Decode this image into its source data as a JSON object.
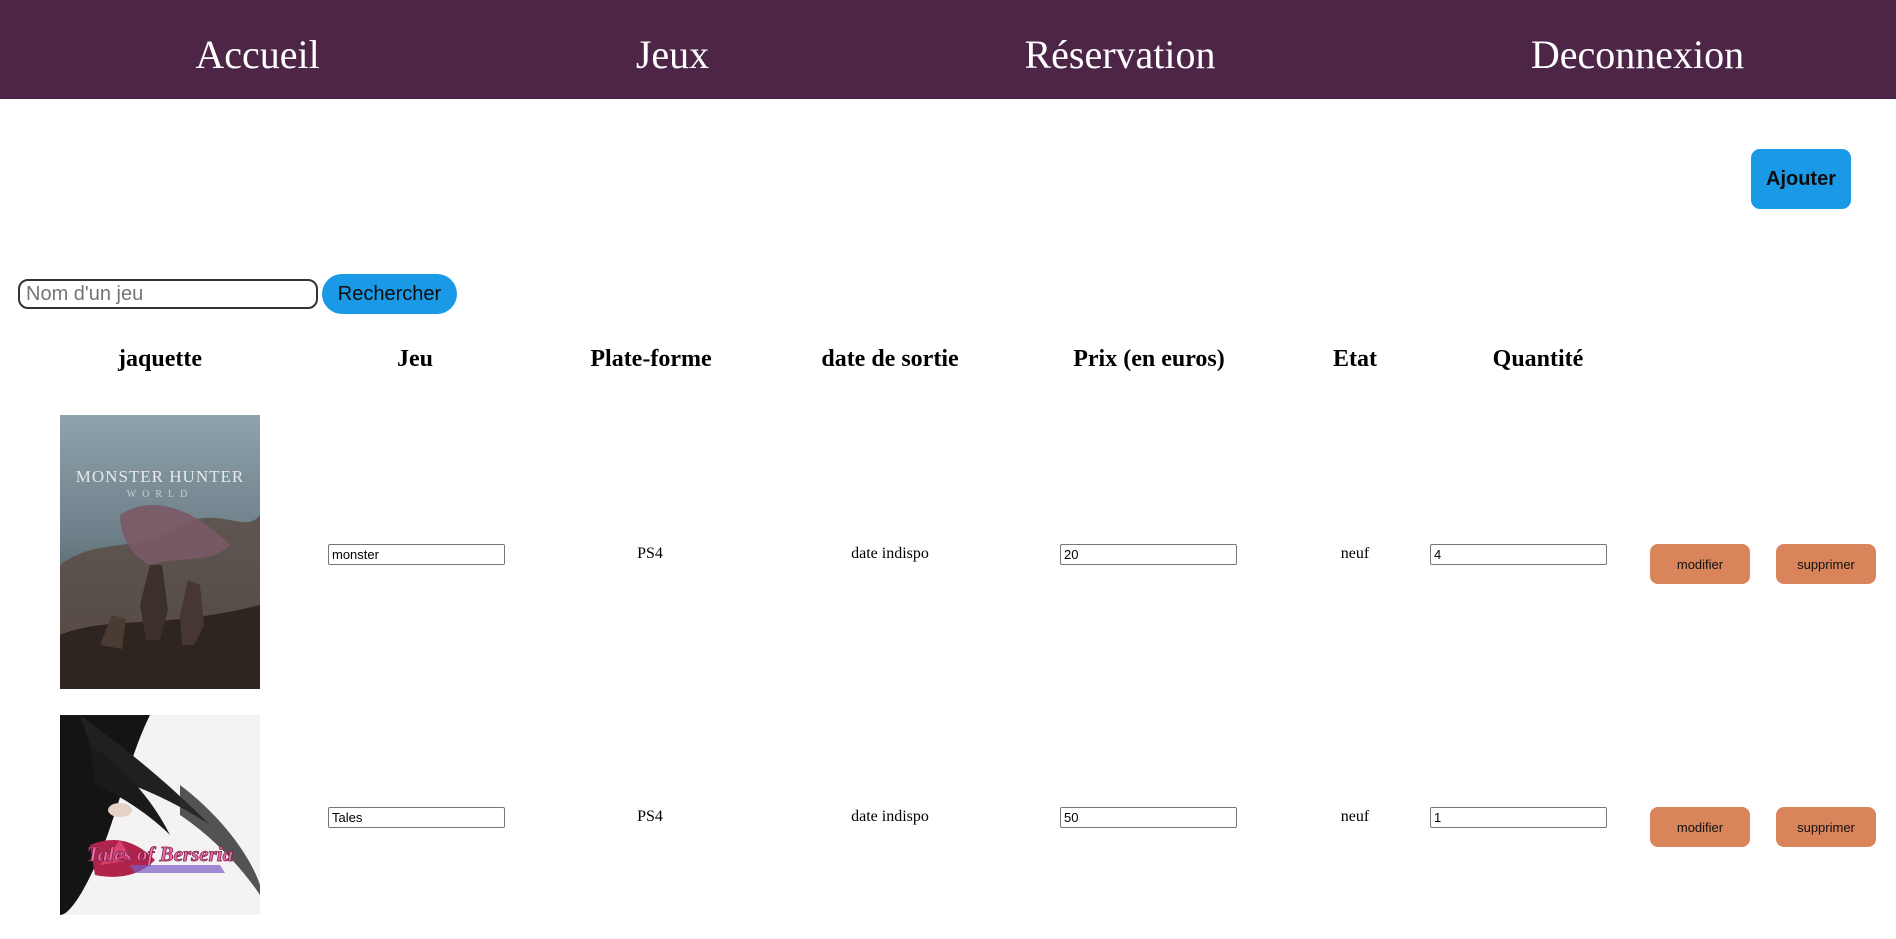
{
  "nav": {
    "items": [
      "Accueil",
      "Jeux",
      "Réservation",
      "Deconnexion"
    ]
  },
  "actions": {
    "add_label": "Ajouter"
  },
  "search": {
    "placeholder": "Nom d'un jeu",
    "value": "",
    "button_label": "Rechercher"
  },
  "table": {
    "headers": [
      "jaquette",
      "Jeu",
      "Plate-forme",
      "date de sortie",
      "Prix (en euros)",
      "Etat",
      "Quantité"
    ],
    "rows": [
      {
        "cover_title": "MONSTER HUNTER",
        "cover_subtitle": "WORLD",
        "game": "monster",
        "platform": "PS4",
        "release_date": "date indispo",
        "price": "20",
        "state": "neuf",
        "quantity": "4",
        "edit_label": "modifier",
        "delete_label": "supprimer"
      },
      {
        "cover_title": "Tales of Berseria",
        "cover_subtitle": "",
        "game": "Tales",
        "platform": "PS4",
        "release_date": "date indispo",
        "price": "50",
        "state": "neuf",
        "quantity": "1",
        "edit_label": "modifier",
        "delete_label": "supprimer"
      }
    ]
  },
  "colors": {
    "navbar": "#4d2547",
    "primary_button": "#1a9ae6",
    "row_button": "#d9845a"
  }
}
